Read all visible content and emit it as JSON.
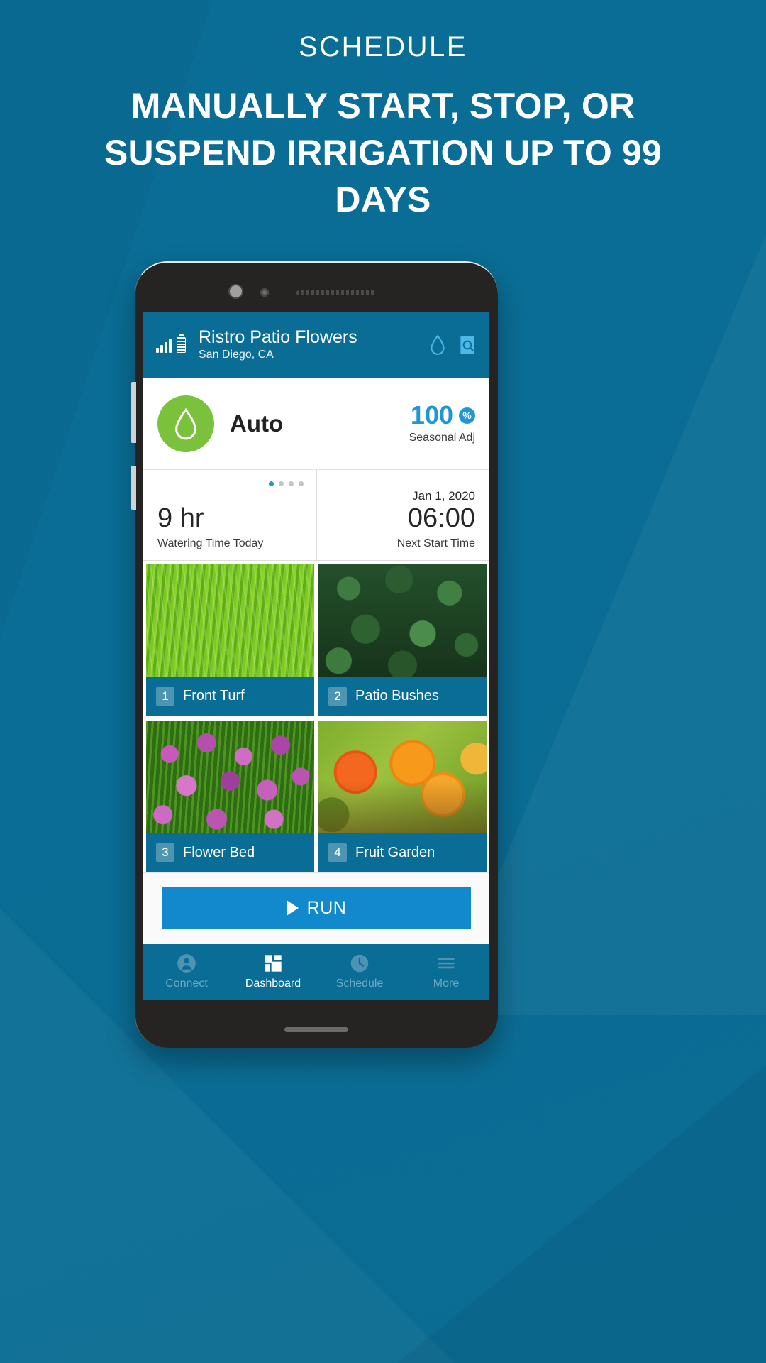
{
  "promo": {
    "eyebrow": "SCHEDULE",
    "headline": "MANUALLY START, STOP, OR SUSPEND IRRIGATION UP TO 99 DAYS"
  },
  "colors": {
    "brand_blue": "#0a6d95",
    "accent_blue": "#2196d6",
    "run_blue": "#1189cc",
    "drop_green": "#7ac13c"
  },
  "app": {
    "header": {
      "title": "Ristro Patio Flowers",
      "subtitle": "San Diego, CA",
      "status_icons": [
        "signal-bars-icon",
        "battery-icon"
      ],
      "actions": [
        "water-drop-icon",
        "report-search-icon"
      ]
    },
    "mode": {
      "icon": "water-drop-icon",
      "label": "Auto",
      "seasonal_value": "100",
      "seasonal_unit": "%",
      "seasonal_caption": "Seasonal Adj"
    },
    "stats": {
      "page_dots": 4,
      "active_dot": 1,
      "watering_time_value": "9 hr",
      "watering_time_caption": "Watering Time Today",
      "next_start_date": "Jan 1, 2020",
      "next_start_value": "06:00",
      "next_start_caption": "Next Start Time"
    },
    "zones": [
      {
        "number": "1",
        "name": "Front Turf",
        "art": "art-grass"
      },
      {
        "number": "2",
        "name": "Patio Bushes",
        "art": "art-bush"
      },
      {
        "number": "3",
        "name": "Flower Bed",
        "art": "art-flowers"
      },
      {
        "number": "4",
        "name": "Fruit Garden",
        "art": "art-fruit"
      }
    ],
    "run_button": {
      "label": "RUN",
      "icon": "play-icon"
    },
    "bottom_nav": [
      {
        "label": "Connect",
        "icon": "person-circle-icon",
        "active": false
      },
      {
        "label": "Dashboard",
        "icon": "grid-squares-icon",
        "active": true
      },
      {
        "label": "Schedule",
        "icon": "clock-icon",
        "active": false
      },
      {
        "label": "More",
        "icon": "hamburger-icon",
        "active": false
      }
    ]
  }
}
